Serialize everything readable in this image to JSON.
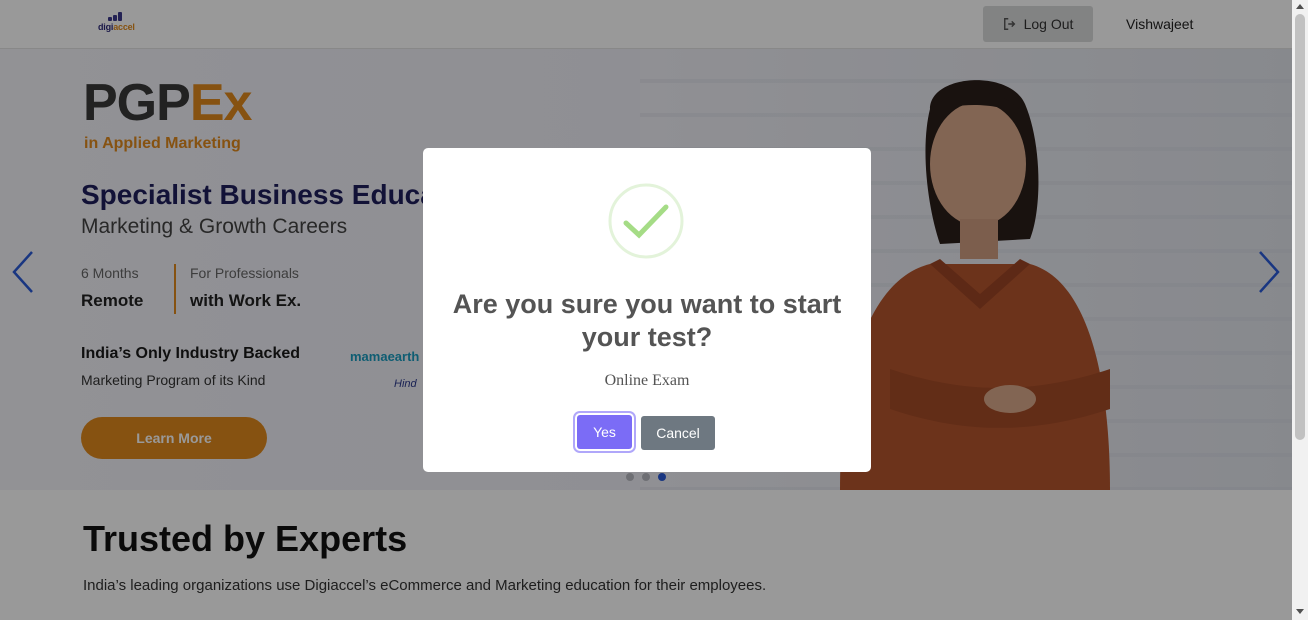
{
  "header": {
    "logo_text_a": "digi",
    "logo_text_b": "accel",
    "logout_label": "Log Out",
    "username": "Vishwajeet"
  },
  "banner": {
    "program_a": "PGP",
    "program_b": "Ex",
    "program_sub": "in Applied Marketing",
    "headline": "Specialist Business Educat",
    "subheadline": "Marketing & Growth Careers",
    "fact1_label": "6 Months",
    "fact1_value": "Remote",
    "fact2_label": "For Professionals",
    "fact2_value": "with Work Ex.",
    "industry_title": "India’s Only Industry Backed",
    "industry_sub": "Marketing Program of its Kind",
    "partner1": "mamaearth",
    "partner2": "Hind",
    "cta_label": "Learn More",
    "slides_total": 3,
    "active_slide": 3
  },
  "section": {
    "title": "Trusted by Experts",
    "subtitle": "India’s leading organizations use Digiaccel’s eCommerce and Marketing education for their employees."
  },
  "modal": {
    "title": "Are you sure you want to start your test?",
    "text": "Online Exam",
    "confirm_label": "Yes",
    "cancel_label": "Cancel",
    "icon": "success-check-icon"
  },
  "colors": {
    "brand_orange": "#e0891d",
    "brand_navy": "#1f1f5c",
    "confirm_button": "#7b6cf6",
    "cancel_button": "#6e7881",
    "check_green": "#a5dc86",
    "arrow_blue": "#2a5bd7"
  }
}
